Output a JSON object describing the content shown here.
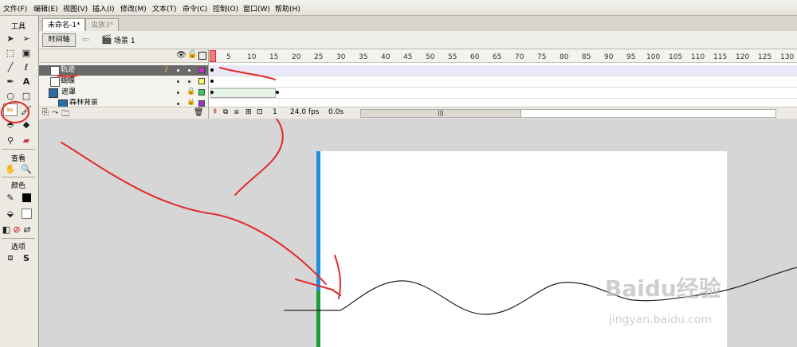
{
  "menu": [
    "文件(F)",
    "编辑(E)",
    "视图(V)",
    "插入(I)",
    "修改(M)",
    "文本(T)",
    "命令(C)",
    "控制(O)",
    "窗口(W)",
    "帮助(H)"
  ],
  "toolbox": {
    "title": "工具",
    "view_label": "查看",
    "colors_label": "颜色",
    "options_label": "选项"
  },
  "doc_tabs": [
    "未命名-1*",
    "虫族3*"
  ],
  "scene": {
    "timeline_button": "时间轴",
    "scene_name": "场景 1"
  },
  "layers": [
    {
      "name": "轨迹",
      "color": "#cc33cc",
      "selected": true
    },
    {
      "name": "蝴蝶",
      "color": "#ffff66",
      "selected": false
    },
    {
      "name": "遮罩",
      "color": "#33cc66",
      "selected": false
    },
    {
      "name": "森林背景",
      "color": "#9933cc",
      "selected": false
    }
  ],
  "frame_ruler": [
    "5",
    "10",
    "15",
    "20",
    "25",
    "30",
    "35",
    "40",
    "45",
    "50",
    "55",
    "60",
    "65",
    "70",
    "75",
    "80",
    "85",
    "90",
    "95",
    "100",
    "105",
    "110",
    "115",
    "120",
    "125",
    "130"
  ],
  "status": {
    "current_frame": "1",
    "fps": "24.0 fps",
    "time": "0.0s"
  },
  "colors": {
    "annotation_red": "#e32a2a",
    "layer_highlight": "#6a6a6a",
    "stage_bg": "#ffffff",
    "blue_bar": "#1e8fe0",
    "green_bar": "#1f9a3a"
  },
  "watermark": {
    "brand": "Baidu经验",
    "url": "jingyan.baidu.com"
  }
}
